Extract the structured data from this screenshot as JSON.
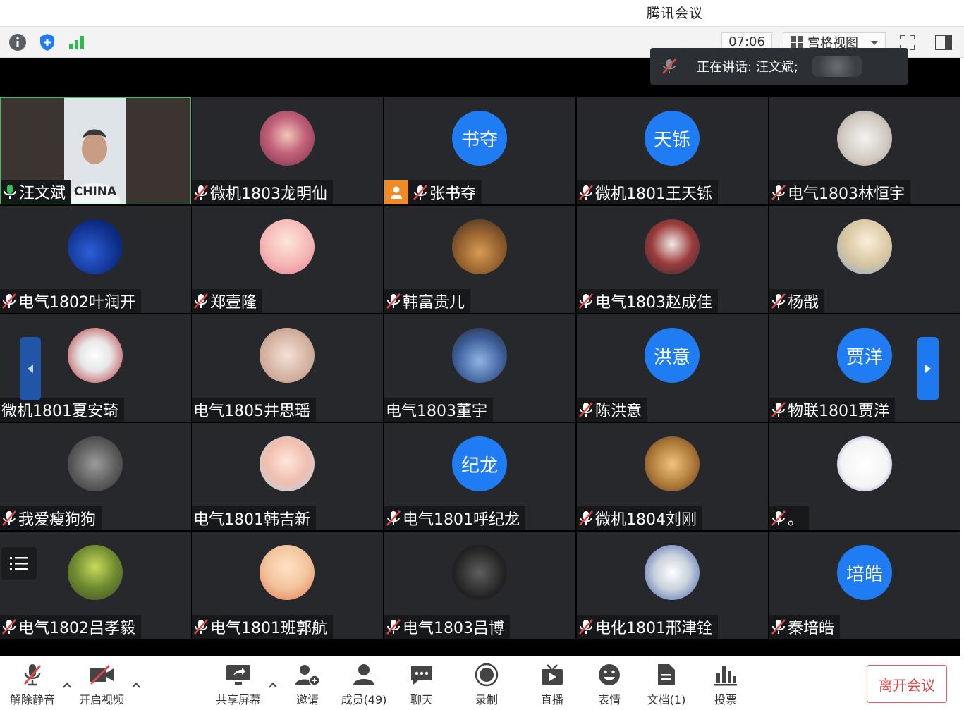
{
  "window": {
    "title": "腾讯会议"
  },
  "topbar": {
    "timer": "07:06",
    "view_label": "宫格视图",
    "icons": [
      "info-icon",
      "shield-icon",
      "signal-icon",
      "fullscreen-icon",
      "sidebar-toggle-icon"
    ]
  },
  "speaker_popup": {
    "text": "正在讲话: 汪文斌;"
  },
  "colors": {
    "accent": "#1f7cf2",
    "leave": "#e04848",
    "host_badge": "#f08a24",
    "speaking": "#35c55b"
  },
  "participants": [
    {
      "name": "汪文斌",
      "avatar": "video",
      "mic": "speaking"
    },
    {
      "name": "微机1803龙明仙",
      "avatar": "photo-girl",
      "mic": "muted"
    },
    {
      "name": "张书夺",
      "avatar_text": "书夺",
      "mic": "muted",
      "host": true
    },
    {
      "name": "微机1801王天铄",
      "avatar_text": "天铄",
      "mic": "muted"
    },
    {
      "name": "电气1803林恒宇",
      "avatar": "photo-snow",
      "mic": "muted"
    },
    {
      "name": "电气1802叶润开",
      "avatar": "photo-sky",
      "mic": "muted"
    },
    {
      "name": "郑壹隆",
      "avatar": "photo-cartoon-boy",
      "mic": "muted"
    },
    {
      "name": "韩富贵儿",
      "avatar": "photo-dog",
      "mic": "muted"
    },
    {
      "name": "电气1803赵成佳",
      "avatar": "photo-mask",
      "mic": "muted"
    },
    {
      "name": "杨戬",
      "avatar": "photo-anime",
      "mic": "muted"
    },
    {
      "name": "微机1801夏安琦",
      "avatar": "photo-kitty",
      "mic": "none"
    },
    {
      "name": "电气1805井思瑶",
      "avatar": "photo-figure",
      "mic": "none"
    },
    {
      "name": "电气1803董宇",
      "avatar": "photo-player",
      "mic": "none"
    },
    {
      "name": "陈洪意",
      "avatar_text": "洪意",
      "mic": "muted"
    },
    {
      "name": "物联1801贾洋",
      "avatar_text": "贾洋",
      "mic": "muted"
    },
    {
      "name": "我爱瘦狗狗",
      "avatar": "photo-street",
      "mic": "muted"
    },
    {
      "name": "电气1801韩吉新",
      "avatar": "photo-baby",
      "mic": "none"
    },
    {
      "name": "电气1801呼纪龙",
      "avatar_text": "纪龙",
      "mic": "muted"
    },
    {
      "name": "微机1804刘刚",
      "avatar": "photo-cat",
      "mic": "muted"
    },
    {
      "name": "。",
      "avatar": "photo-meme",
      "mic": "muted"
    },
    {
      "name": "电气1802吕孝毅",
      "avatar": "photo-tree",
      "mic": "muted"
    },
    {
      "name": "电气1801班郭航",
      "avatar": "photo-cartoon-kid",
      "mic": "muted"
    },
    {
      "name": "电气1803吕博",
      "avatar": "photo-dark",
      "mic": "muted"
    },
    {
      "name": "电化1801邢津铨",
      "avatar": "photo-gundam",
      "mic": "muted"
    },
    {
      "name": "秦培皓",
      "avatar_text": "培皓",
      "mic": "muted"
    }
  ],
  "video_feed_text": "CHINA",
  "bottombar": {
    "unmute": "解除静音",
    "start_video": "开启视频",
    "share_screen": "共享屏幕",
    "invite": "邀请",
    "members": "成员(49)",
    "chat": "聊天",
    "record": "录制",
    "live": "直播",
    "reactions": "表情",
    "docs": "文档(1)",
    "vote": "投票",
    "leave": "离开会议"
  }
}
